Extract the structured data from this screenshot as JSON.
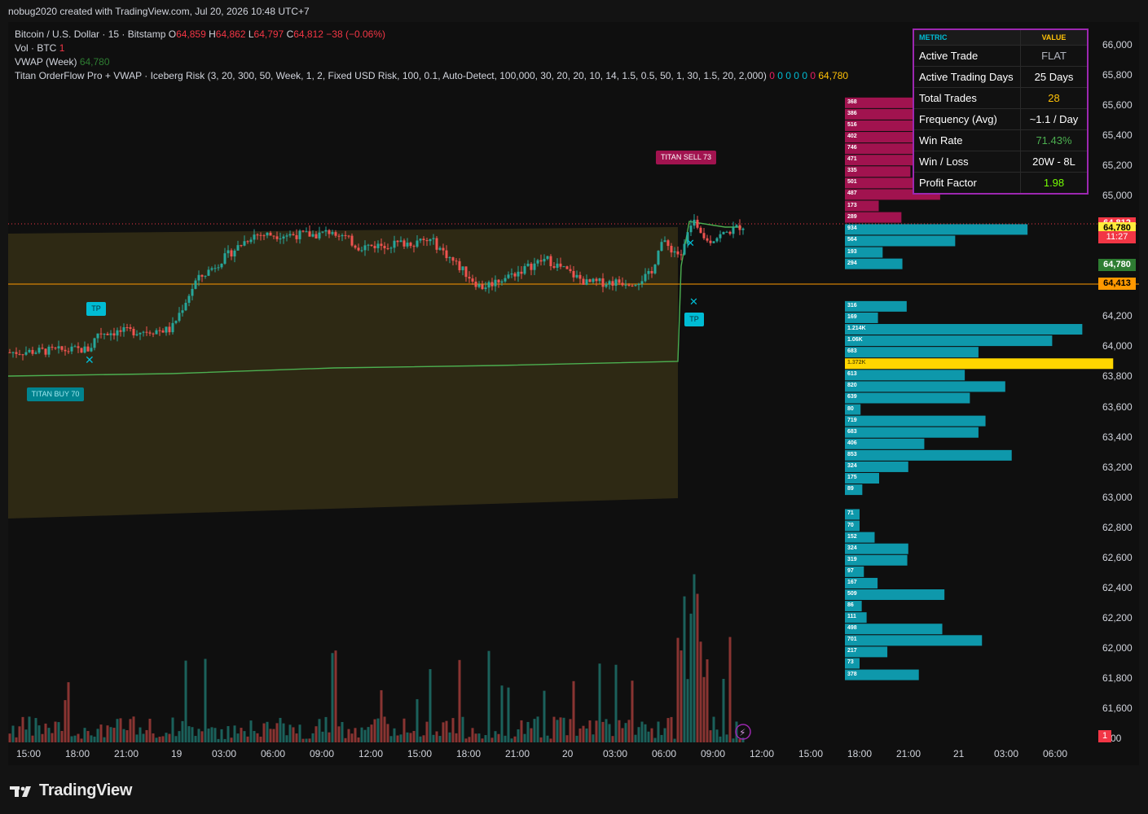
{
  "header": {
    "attribution": "nobug2020 created with TradingView.com, Jul 20, 2026 10:48 UTC+7"
  },
  "legend": {
    "symbol": "Bitcoin / U.S. Dollar · 15 · Bitstamp",
    "ohlc": {
      "o_label": "O",
      "o": "64,859",
      "h_label": "H",
      "h": "64,862",
      "l_label": "L",
      "l": "64,797",
      "c_label": "C",
      "c": "64,812",
      "change": "−38 (−0.06%)"
    },
    "vol": {
      "label": "Vol · BTC",
      "value": "1"
    },
    "vwap": {
      "label": "VWAP (Week)",
      "value": "64,780"
    },
    "indicator": {
      "label": "Titan OrderFlow Pro + VWAP · Iceberg Risk (3, 20, 300, 50, Week, 1, 2, Fixed USD Risk, 100, 0.1, Auto-Detect, 100,000, 30, 20, 20, 10, 14, 1.5, 0.5, 50, 1, 30, 1.5, 20, 2,000)",
      "zeros": [
        "0",
        "0",
        "0",
        "0",
        "0",
        "0"
      ],
      "value": "64,780"
    }
  },
  "metrics_table": {
    "header_metric": "METRIC",
    "header_value": "VALUE",
    "rows": [
      {
        "metric": "Active Trade",
        "value": "FLAT",
        "color": "#b2b5be"
      },
      {
        "metric": "Active Trading Days",
        "value": "25 Days",
        "color": "#ffffff"
      },
      {
        "metric": "Total Trades",
        "value": "28",
        "color": "#ffc107"
      },
      {
        "metric": "Frequency (Avg)",
        "value": "~1.1 / Day",
        "color": "#ffffff"
      },
      {
        "metric": "Win Rate",
        "value": "71.43%",
        "color": "#4caf50"
      },
      {
        "metric": "Win / Loss",
        "value": "20W - 8L",
        "color": "#ffffff"
      },
      {
        "metric": "Profit Factor",
        "value": "1.98",
        "color": "#76ff03"
      }
    ]
  },
  "y_axis": [
    {
      "price": 66000,
      "label": "66,000"
    },
    {
      "price": 65800,
      "label": "65,800"
    },
    {
      "price": 65600,
      "label": "65,600"
    },
    {
      "price": 65400,
      "label": "65,400"
    },
    {
      "price": 65200,
      "label": "65,200"
    },
    {
      "price": 65000,
      "label": "65,000"
    },
    {
      "price": 64200,
      "label": "64,200"
    },
    {
      "price": 64000,
      "label": "64,000"
    },
    {
      "price": 63800,
      "label": "63,800"
    },
    {
      "price": 63600,
      "label": "63,600"
    },
    {
      "price": 63400,
      "label": "63,400"
    },
    {
      "price": 63200,
      "label": "63,200"
    },
    {
      "price": 63000,
      "label": "63,000"
    },
    {
      "price": 62800,
      "label": "62,800"
    },
    {
      "price": 62600,
      "label": "62,600"
    },
    {
      "price": 62400,
      "label": "62,400"
    },
    {
      "price": 62200,
      "label": "62,200"
    },
    {
      "price": 62000,
      "label": "62,000"
    },
    {
      "price": 61800,
      "label": "61,800"
    },
    {
      "price": 61600,
      "label": "61,600"
    },
    {
      "price": 61400,
      "label": ".400"
    }
  ],
  "price_badges": [
    {
      "price": 64812,
      "label": "64,812",
      "bg": "#f23645",
      "fg": "#ffffff"
    },
    {
      "price": 64780,
      "label": "64,780",
      "bg": "#ffeb3b",
      "fg": "#000000"
    },
    {
      "price": 64413,
      "label": "64,413",
      "bg": "#ff9800",
      "fg": "#000000"
    }
  ],
  "countdown": "11:27",
  "vwap_badge": "64,780",
  "vol_badge": "1",
  "x_axis": [
    "15:00",
    "18:00",
    "21:00",
    "19",
    "03:00",
    "06:00",
    "09:00",
    "12:00",
    "15:00",
    "18:00",
    "21:00",
    "20",
    "03:00",
    "06:00",
    "09:00",
    "12:00",
    "15:00",
    "18:00",
    "21:00",
    "21",
    "03:00",
    "06:00"
  ],
  "tags": {
    "tp": "TP",
    "buy": "TITAN BUY 70",
    "sell": "TITAN SELL 73"
  },
  "volume_profile": {
    "sell_levels": [
      "368",
      "386",
      "516",
      "402",
      "746",
      "471",
      "335",
      "501",
      "487",
      "173",
      "289"
    ],
    "buy_levels_a": [
      "934",
      "564",
      "193",
      "294"
    ],
    "buy_levels_b": [
      "316",
      "169",
      "1.214K",
      "1.06K",
      "683",
      "1.372K",
      "613",
      "820",
      "639",
      "80",
      "719",
      "683",
      "406",
      "853",
      "324",
      "175",
      "89"
    ],
    "buy_levels_c": [
      "71",
      "70",
      "152",
      "324",
      "319",
      "97",
      "167",
      "509",
      "86",
      "111",
      "498",
      "701",
      "217",
      "73",
      "378"
    ]
  },
  "footer": {
    "brand": "TradingView"
  },
  "colors": {
    "up": "#26a69a",
    "down": "#ef5350",
    "sell_zone": "#a1134f",
    "buy_zone": "#0e98ab",
    "poc": "#ffd600",
    "vwap": "#4caf50",
    "line_orange": "#ff9800"
  }
}
